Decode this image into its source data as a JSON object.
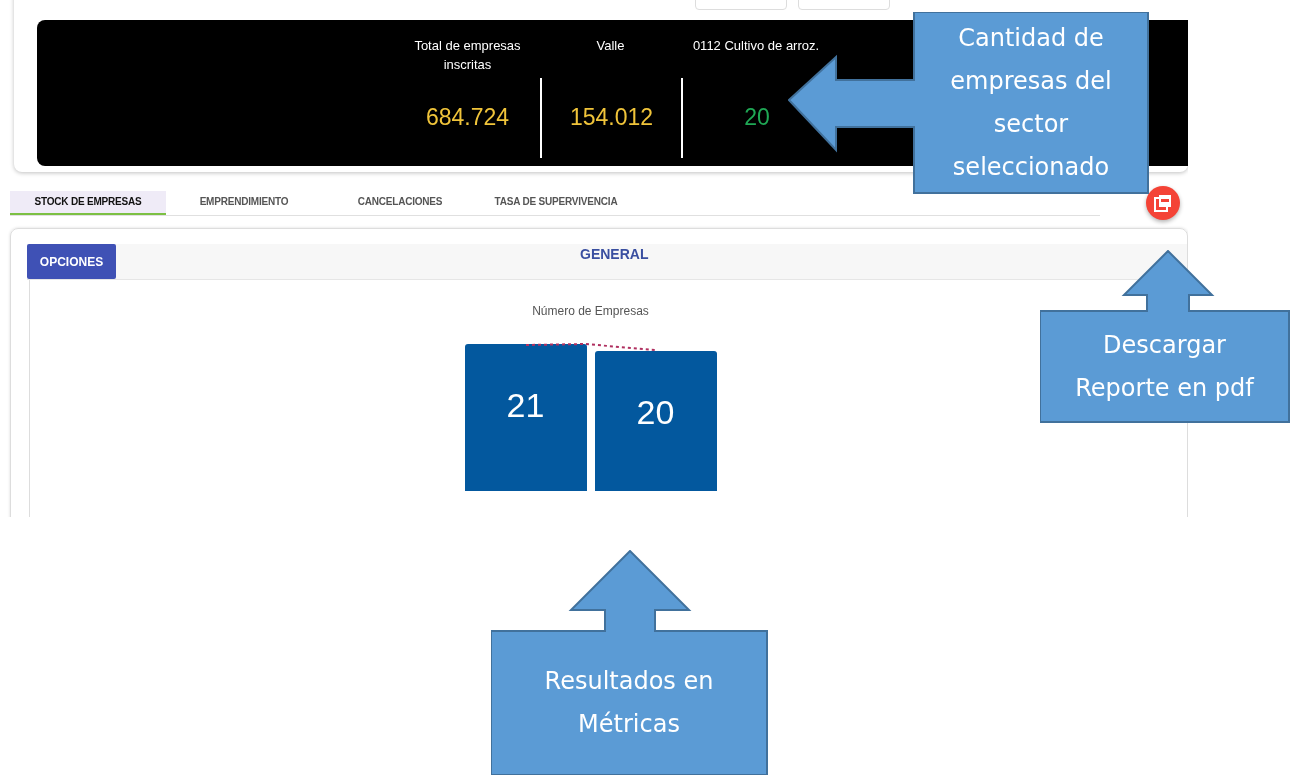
{
  "summary": {
    "stats": [
      {
        "label": "Total de empresas inscritas",
        "value": "684.724",
        "color": "#f0c43a"
      },
      {
        "label": "Valle",
        "value": "154.012",
        "color": "#f0c43a"
      },
      {
        "label": "0112 Cultivo de arroz.",
        "value": "20",
        "color": "#1fa855"
      }
    ]
  },
  "tabs": [
    {
      "label": "STOCK DE EMPRESAS",
      "selected": true
    },
    {
      "label": "EMPRENDIMIENTO",
      "selected": false
    },
    {
      "label": "CANCELACIONES",
      "selected": false
    },
    {
      "label": "TASA DE SUPERVIVENCIA",
      "selected": false
    }
  ],
  "panel": {
    "options_button": "OPCIONES",
    "title": "GENERAL",
    "metric_title": "Número de Empresas",
    "metrics": [
      {
        "value": "21"
      },
      {
        "value": "20"
      }
    ]
  },
  "callouts": [
    {
      "kind": "left",
      "text": "Cantidad de empresas del sector seleccionado"
    },
    {
      "kind": "up",
      "text": "Descargar Reporte en pdf"
    },
    {
      "kind": "up",
      "text": "Resultados en Métricas"
    }
  ]
}
